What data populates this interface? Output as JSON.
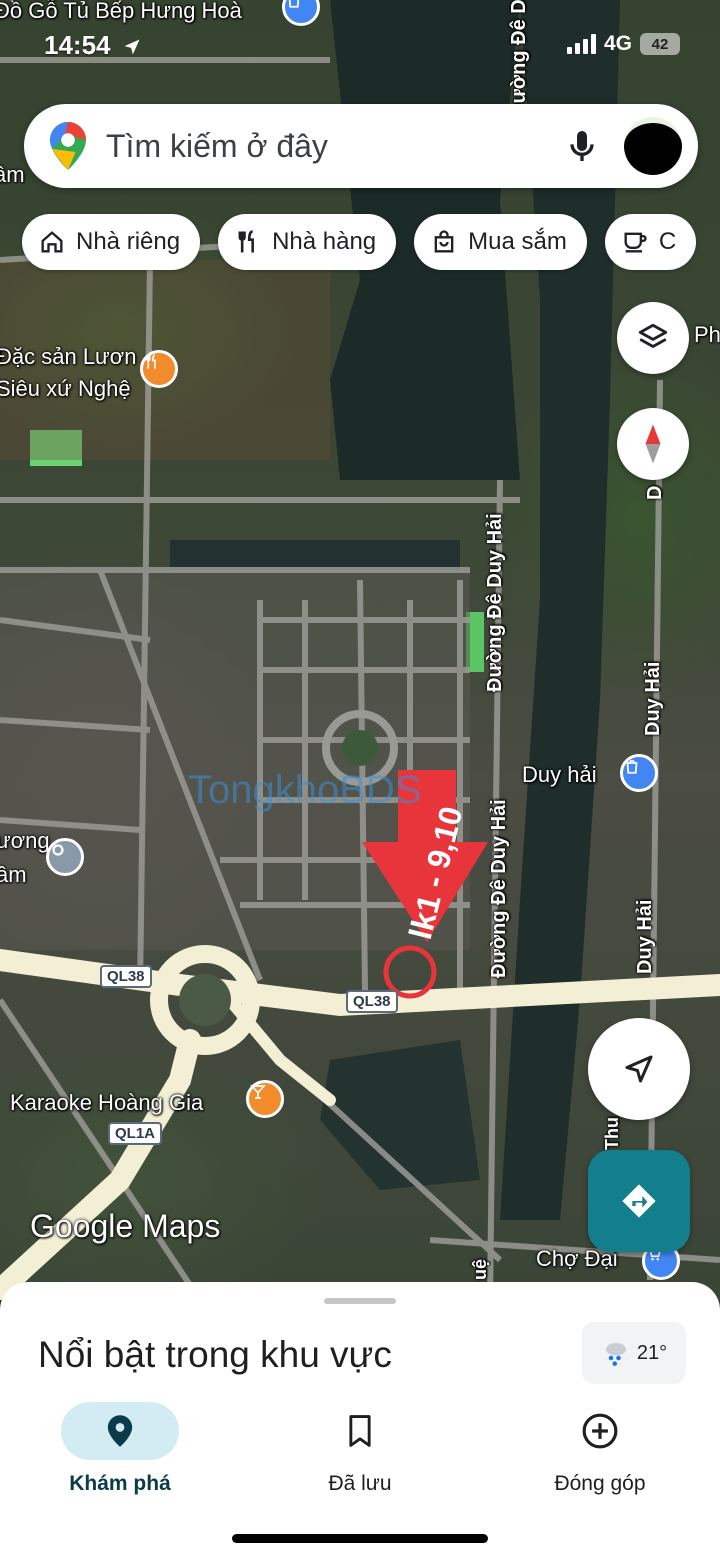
{
  "status_bar": {
    "time": "14:54",
    "network": "4G",
    "battery": "42"
  },
  "search": {
    "placeholder": "Tìm kiếm ở đây"
  },
  "chips": [
    {
      "label": "Nhà riêng",
      "icon": "home-icon"
    },
    {
      "label": "Nhà hàng",
      "icon": "restaurant-icon"
    },
    {
      "label": "Mua sắm",
      "icon": "shopping-bag-icon"
    },
    {
      "label": "C",
      "icon": "cafe-icon"
    }
  ],
  "map": {
    "labels": {
      "top_place": "Đồ Gỗ Tủ Bếp Hưng Hoà",
      "top_left": "âm",
      "restaurant_line1": "Đặc sản Lươn",
      "restaurant_line2": "Siêu xứ Nghệ",
      "right_ph": "Ph",
      "road_duy_hai_top": "Đường Đê Duy",
      "road_de_duy_hai": "Đường Đê Duy Hải",
      "road_de_duy_hai_lower": "Đường Đê Duy Hải",
      "road_duy_hai_right1": "Duy Hải",
      "road_duy_hai_right2": "Duy Hải",
      "road_d_right": "D",
      "shop_duy_hai": "Duy hải",
      "left_poi_line1": "ương",
      "left_poi_line2": "âm",
      "karaoke": "Karaoke Hoàng Gia",
      "cho_dai": "Chợ Đại",
      "vertical_thu": "Thu",
      "vertical_hue": "uệ",
      "watermark": "TongkhoBDS"
    },
    "shields": {
      "ql38_left": "QL38",
      "ql38_center": "QL38",
      "ql1a": "QL1A"
    },
    "annotation": "lk1 - 9,10",
    "brand": "Google Maps",
    "colors": {
      "annotation_red": "#e8353b",
      "road": "#f3efd5"
    }
  },
  "weather": {
    "temp": "21°"
  },
  "sheet": {
    "title": "Nổi bật trong khu vực"
  },
  "nav": [
    {
      "label": "Khám phá",
      "icon": "location-pin-icon",
      "active": true
    },
    {
      "label": "Đã lưu",
      "icon": "bookmark-icon",
      "active": false
    },
    {
      "label": "Đóng góp",
      "icon": "add-circle-icon",
      "active": false
    }
  ]
}
